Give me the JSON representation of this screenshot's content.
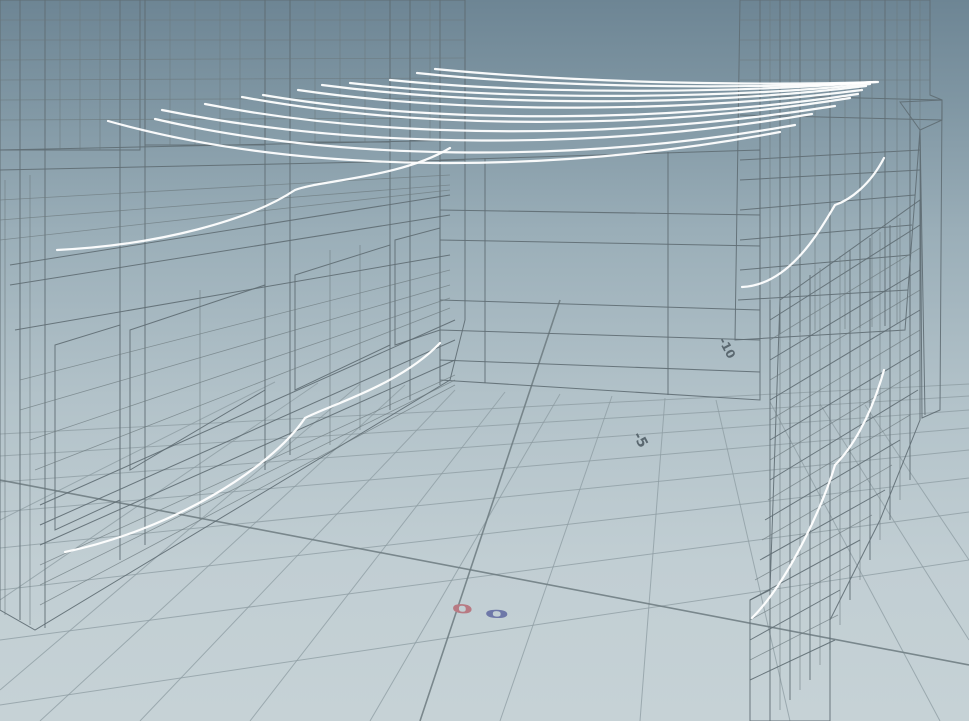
{
  "viewport": {
    "background_top": "#6d8594",
    "background_bottom": "#c6d2d6",
    "wireframe_color": "#5f6d73",
    "curve_color": "#ffffff"
  },
  "grid_labels": {
    "x_origin": "0",
    "z_origin": "0",
    "minus_five": "-5",
    "minus_ten": "-10",
    "x_origin_color": "#b87a83",
    "z_origin_color": "#6e78a8"
  }
}
